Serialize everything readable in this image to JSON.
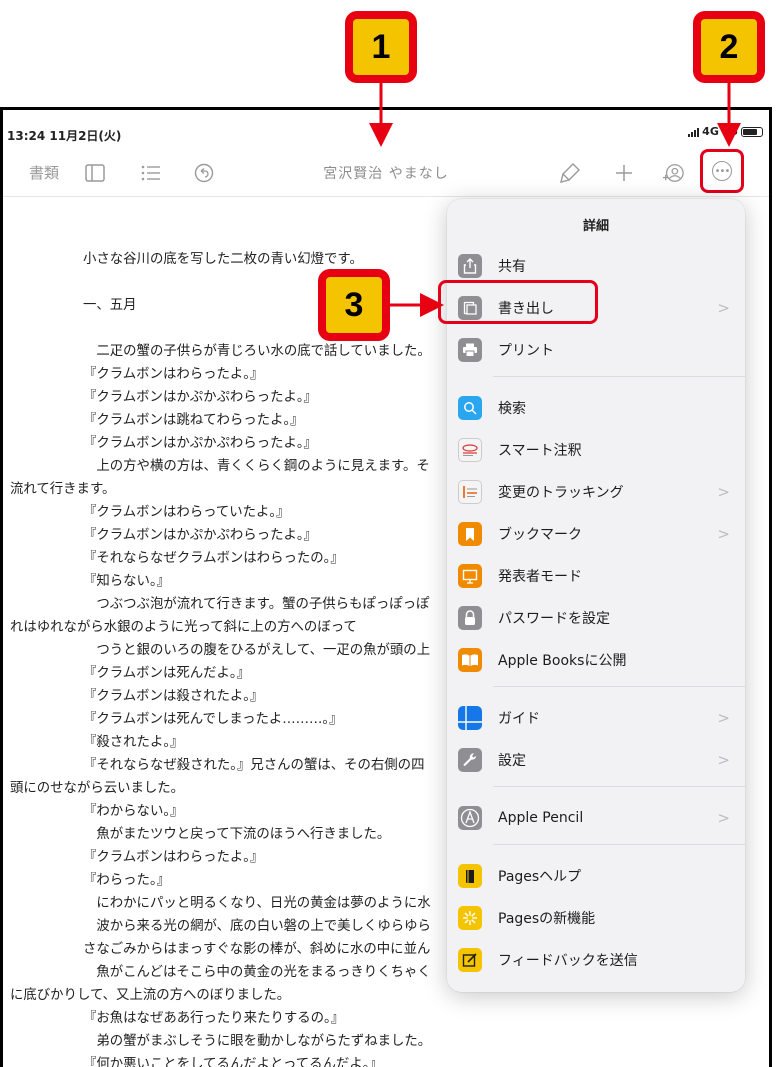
{
  "status_bar": {
    "time": "13:24  11月2日(火)",
    "network": "4G 85"
  },
  "toolbar": {
    "documents_label": "書類",
    "document_title": "宮沢賢治 やまなし"
  },
  "document": {
    "lines": [
      "小さな谷川の底を写した二枚の青い幻燈です。",
      "",
      "一、五月",
      "",
      "　二疋の蟹の子供らが青じろい水の底で話していました。",
      "『クラムボンはわらったよ。』",
      "『クラムボンはかぷかぷわらったよ。』",
      "『クラムボンは跳ねてわらったよ。』",
      "『クラムボンはかぷかぷわらったよ。』",
      "　上の方や横の方は、青くくらく鋼のように見えます。そ",
      "流れて行きます。",
      "『クラムボンはわらっていたよ。』",
      "『クラムボンはかぷかぷわらったよ。』",
      "『それならなぜクラムボンはわらったの。』",
      "『知らない。』",
      "　つぶつぶ泡が流れて行きます。蟹の子供らもぽっぽっぽ",
      "れはゆれながら水銀のように光って斜に上の方へのぼって",
      "　つうと銀のいろの腹をひるがえして、一疋の魚が頭の上",
      "『クラムボンは死んだよ。』",
      "『クラムボンは殺されたよ。』",
      "『クラムボンは死んでしまったよ………。』",
      "『殺されたよ。』",
      "『それならなぜ殺された。』兄さんの蟹は、その右側の四",
      "頭にのせながら云いました。",
      "『わからない。』",
      "　魚がまたツウと戻って下流のほうへ行きました。",
      "『クラムボンはわらったよ。』",
      "『わらった。』",
      "　にわかにパッと明るくなり、日光の黄金は夢のように水",
      "　波から来る光の網が、底の白い磐の上で美しくゆらゆら",
      "さなごみからはまっすぐな影の棒が、斜めに水の中に並ん",
      "　魚がこんどはそこら中の黄金の光をまるっきりくちゃく",
      "に底びかりして、又上流の方へのぼりました。",
      "『お魚はなぜああ行ったり来たりするの。』",
      "　弟の蟹がまぶしそうに眼を動かしながらたずねました。",
      "『何か悪いことをしてるんだよとってるんだよ。』"
    ]
  },
  "popover": {
    "title": "詳細",
    "items": [
      {
        "label": "共有",
        "icon": "share-icon",
        "chevron": false
      },
      {
        "label": "書き出し",
        "icon": "export-icon",
        "chevron": true
      },
      {
        "label": "プリント",
        "icon": "print-icon",
        "chevron": false
      },
      {
        "label": "検索",
        "icon": "search-icon",
        "chevron": false
      },
      {
        "label": "スマート注釈",
        "icon": "smart-annotation-icon",
        "chevron": false
      },
      {
        "label": "変更のトラッキング",
        "icon": "track-changes-icon",
        "chevron": true
      },
      {
        "label": "ブックマーク",
        "icon": "bookmark-icon",
        "chevron": true
      },
      {
        "label": "発表者モード",
        "icon": "presenter-icon",
        "chevron": false
      },
      {
        "label": "パスワードを設定",
        "icon": "lock-icon",
        "chevron": false
      },
      {
        "label": "Apple Booksに公開",
        "icon": "books-icon",
        "chevron": false
      },
      {
        "label": "ガイド",
        "icon": "guide-icon",
        "chevron": true
      },
      {
        "label": "設定",
        "icon": "wrench-icon",
        "chevron": true
      },
      {
        "label": "Apple Pencil",
        "icon": "pencil-icon",
        "chevron": true
      },
      {
        "label": "Pagesヘルプ",
        "icon": "help-icon",
        "chevron": false
      },
      {
        "label": "Pagesの新機能",
        "icon": "sparkle-icon",
        "chevron": false
      },
      {
        "label": "フィードバックを送信",
        "icon": "feedback-icon",
        "chevron": false
      }
    ]
  },
  "callouts": {
    "one": "1",
    "two": "2",
    "three": "3"
  },
  "colors": {
    "callout_red": "#e60012",
    "callout_yellow": "#f5c400",
    "highlight_red": "#e4001b"
  }
}
